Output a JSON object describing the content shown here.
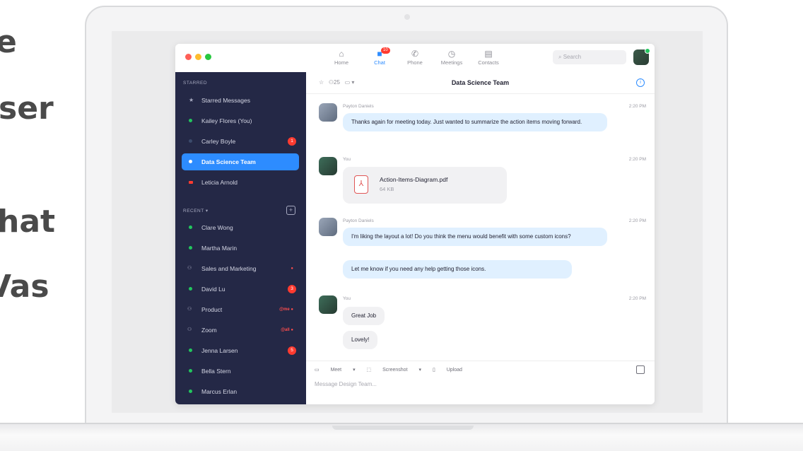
{
  "background": {
    "lines": [
      "e",
      "ser",
      "hat",
      "Vas"
    ]
  },
  "colors": {
    "accent": "#2d8cff",
    "sidebar_bg": "#242846",
    "badge_red": "#ff3b30",
    "bubble_blue": "#e0f0ff"
  },
  "topnav": {
    "items": [
      {
        "label": "Home",
        "icon": "home-icon"
      },
      {
        "label": "Chat",
        "icon": "chat-icon",
        "badge": "10",
        "active": true
      },
      {
        "label": "Phone",
        "icon": "phone-icon"
      },
      {
        "label": "Meetings",
        "icon": "clock-icon"
      },
      {
        "label": "Contacts",
        "icon": "contacts-icon"
      }
    ],
    "search_placeholder": "Search"
  },
  "sidebar": {
    "starred_heading": "STARRED",
    "starred": [
      {
        "label": "Starred Messages",
        "icon": "star-icon"
      },
      {
        "label": "Kailey Flores (You)",
        "status": "online"
      },
      {
        "label": "Carley Boyle",
        "status": "offline",
        "badge": "1"
      },
      {
        "label": "Data Science Team",
        "active": true
      },
      {
        "label": "Leticia Arnold",
        "icon": "video-icon"
      }
    ],
    "recent_heading": "RECENT ▾",
    "recent": [
      {
        "label": "Clare Wong",
        "status": "online"
      },
      {
        "label": "Martha Marin",
        "status": "online"
      },
      {
        "label": "Sales and Marketing",
        "icon": "group-icon",
        "tag": "●"
      },
      {
        "label": "David Lu",
        "status": "online",
        "badge": "3"
      },
      {
        "label": "Product",
        "icon": "group-icon",
        "tag": "@me ●"
      },
      {
        "label": "Zoom",
        "icon": "group-icon",
        "tag": "@all ●"
      },
      {
        "label": "Jenna Larsen",
        "status": "online",
        "badge": "5"
      },
      {
        "label": "Bella Stern",
        "status": "online"
      },
      {
        "label": "Marcus Erlan",
        "status": "online"
      }
    ]
  },
  "chat": {
    "title": "Data Science Team",
    "member_count": "25",
    "messages": [
      {
        "sender": "Payton Daniels",
        "time": "2:20 PM",
        "text": "Thanks again for meeting today. Just wanted to summarize the action items moving forward."
      },
      {
        "sender": "You",
        "time": "2:20 PM",
        "file_name": "Action-Items-Diagram.pdf",
        "file_size": "64 KB"
      },
      {
        "sender": "Payton Daniels",
        "time": "2:20 PM",
        "text": "I'm liking the layout a lot! Do you think the menu would benefit with some custom icons?",
        "text2": "Let me know if you need any help getting those icons."
      },
      {
        "sender": "You",
        "time": "2:20 PM",
        "text": "Great Job",
        "text2": "Lovely!"
      }
    ],
    "composer": {
      "meet": "Meet",
      "screenshot": "Screenshot",
      "upload": "Upload",
      "placeholder": "Message Design Team..."
    }
  }
}
